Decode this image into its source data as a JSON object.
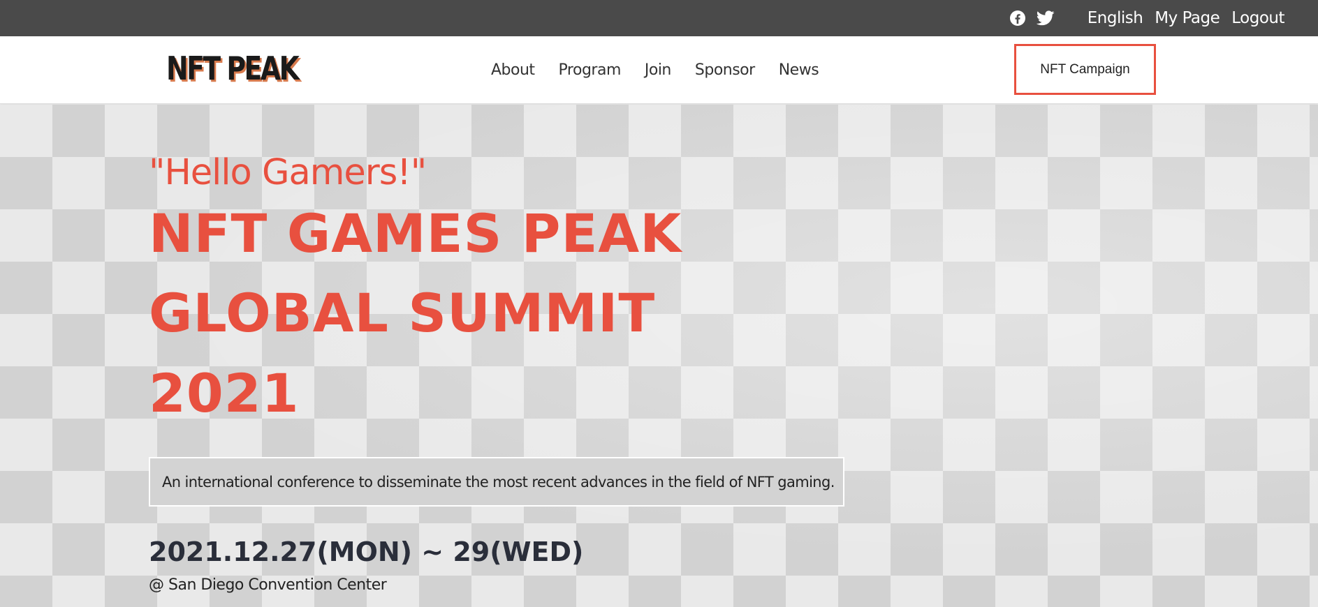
{
  "topbar": {
    "social_icons": [
      "facebook-icon",
      "twitter-icon"
    ],
    "links": {
      "language": "English",
      "my_page": "My Page",
      "logout": "Logout"
    }
  },
  "navbar": {
    "logo_text": "NFT PEAK",
    "menu": [
      "About",
      "Program",
      "Join",
      "Sponsor",
      "News"
    ],
    "campaign_button": "NFT Campaign"
  },
  "hero": {
    "greeting": "\"Hello Gamers!\"",
    "title_lines": [
      "NFT GAMES PEAK",
      "GLOBAL SUMMIT",
      "2021"
    ],
    "description": "An international conference to disseminate the most recent advances in the field of NFT gaming.",
    "date": "2021.12.27(MON) ~ 29(WED)",
    "venue": "@ San Diego Convention Center"
  },
  "colors": {
    "accent": "#e8503f",
    "topbar_bg": "#4a4a4a",
    "date_text": "#2a2e3a"
  }
}
